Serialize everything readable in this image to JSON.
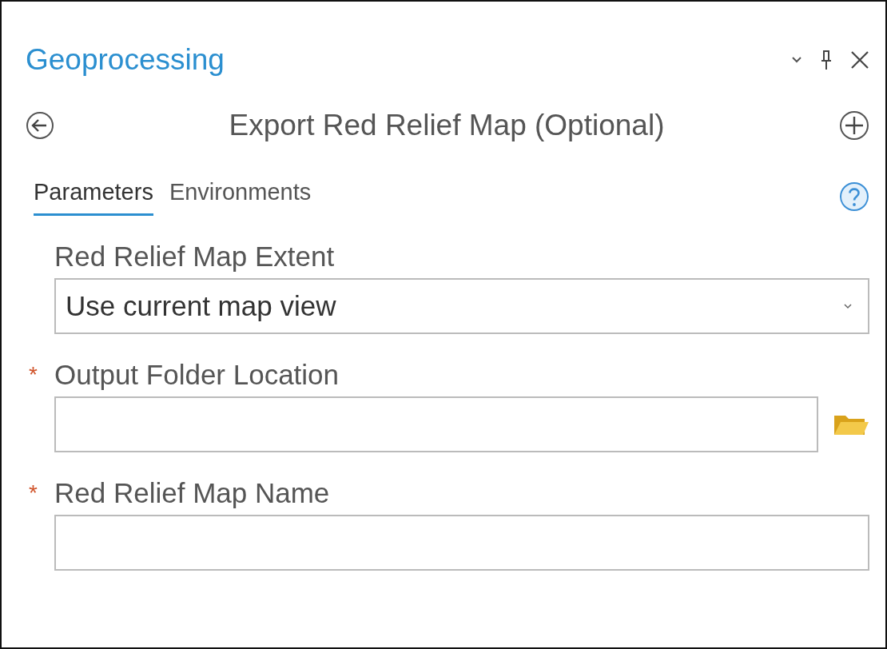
{
  "panel": {
    "title": "Geoprocessing"
  },
  "tool": {
    "title": "Export Red Relief Map (Optional)"
  },
  "tabs": [
    {
      "label": "Parameters",
      "selected": true
    },
    {
      "label": "Environments",
      "selected": false
    }
  ],
  "parameters": [
    {
      "kind": "dropdown",
      "label": "Red Relief Map Extent",
      "value": "Use current map view"
    },
    {
      "kind": "folder",
      "label": "Output Folder Location",
      "required_mark": "*"
    },
    {
      "kind": "text",
      "label": "Red Relief Map Name",
      "required_mark": "*"
    }
  ]
}
